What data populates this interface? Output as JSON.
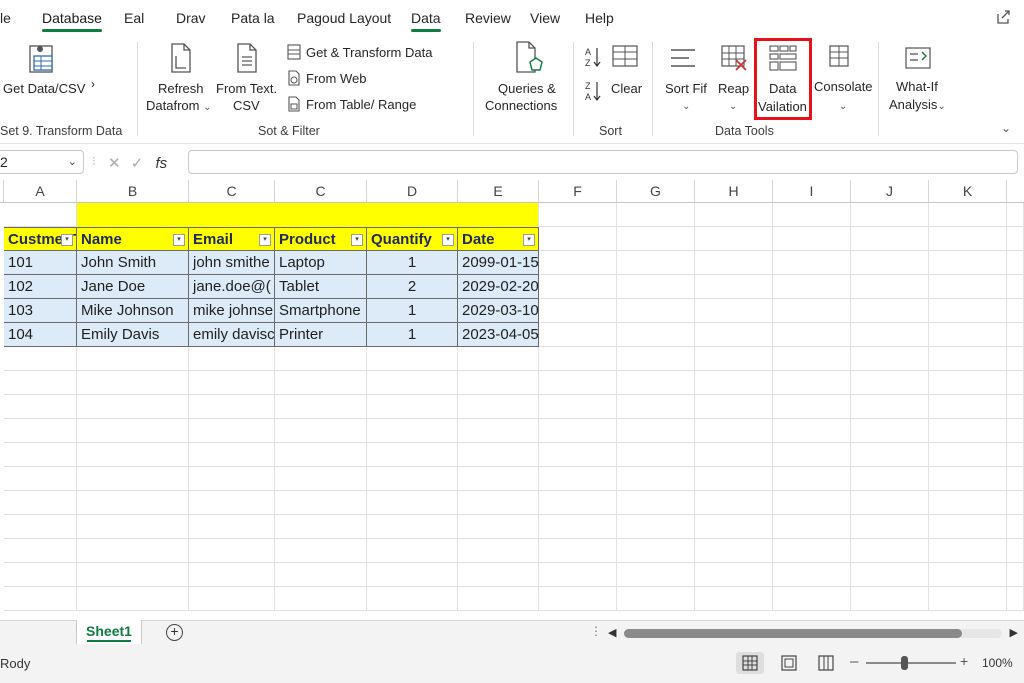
{
  "menu": {
    "tabs": [
      "le",
      "Database",
      "Eal",
      "Drav",
      "Pata la",
      "Pagoud Layout",
      "Data",
      "Review",
      "View",
      "Help"
    ],
    "active_tab": "Data"
  },
  "ribbon": {
    "get_data": "Get Data/CSV",
    "get_data_group": "Set 9. Transform Data",
    "refresh_1": "Refresh",
    "refresh_2": "Datafrom",
    "from_text_1": "From Text.",
    "from_text_2": "CSV",
    "get_transform": "Get  & Transform Data",
    "from_web": "From Web",
    "from_table": "From Table/ Range",
    "group_sort_filter": "Sot & Filter",
    "queries_1": "Queries &",
    "queries_2": "Connections",
    "clear": "Clear",
    "group_sort": "Sort",
    "sort_fif": "Sort Fif",
    "reap": "Reap",
    "data_validation_1": "Data",
    "data_validation_2": "Vailation",
    "consolidate": "Consolate",
    "group_data_tools": "Data Tools",
    "what_if_1": "What-If",
    "what_if_2": "Analysis"
  },
  "formula_bar": {
    "name_box": "2",
    "fx": "fs",
    "formula": ""
  },
  "grid": {
    "columns": [
      "A",
      "B",
      "C",
      "C",
      "D",
      "E",
      "F",
      "G",
      "H",
      "I",
      "J",
      "K"
    ],
    "headers": [
      "Custmer TI",
      "Name",
      "Email",
      "Product",
      "Quantify",
      "Date"
    ],
    "rows": [
      [
        "101",
        "John Smith",
        "john smithe",
        "Laptop",
        "1",
        "2099-01-15"
      ],
      [
        "102",
        "Jane Doe",
        "jane.doe@(",
        "Tablet",
        "2",
        "2029-02-20"
      ],
      [
        "103",
        "Mike Johnson",
        "mike johnse",
        "Smartphone",
        "1",
        "2029-03-10"
      ],
      [
        "104",
        "Emily Davis",
        "emily davisc",
        "Printer",
        "1",
        "2023-04-05"
      ]
    ]
  },
  "sheets": {
    "active": "Sheet1",
    "add": "+"
  },
  "status": {
    "ready": "Rody",
    "zoom": "100%"
  },
  "colors": {
    "accent": "#107c41",
    "header_fill": "#ffff00",
    "table_fill": "#dcebf7",
    "highlight": "#e8101a"
  }
}
